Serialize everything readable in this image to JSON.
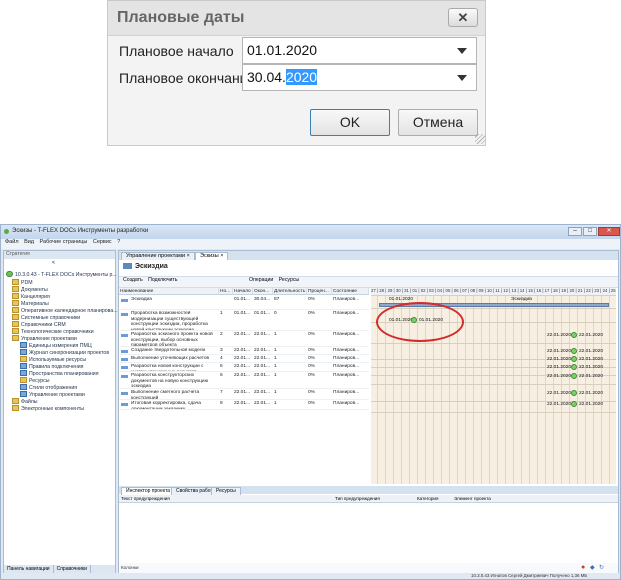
{
  "dialog": {
    "title": "Плановые даты",
    "close_icon": "close-x-icon",
    "start_label": "Плановое начало",
    "start_value": "01.01.2020",
    "end_label": "Плановое окончание",
    "end_value_plain": "30.04.",
    "end_value_selected": "2020",
    "ok_label": "OK",
    "cancel_label": "Отмена"
  },
  "app": {
    "title": "Эскизы - T-FLEX DOCs Инструменты разработки",
    "menu": [
      "Файл",
      "Вид",
      "Рабочие страницы",
      "Сервис",
      "?"
    ],
    "nav": {
      "header": "Стратегия",
      "root": "10.3.0.43 - T-FLEX DOCs Инструменты р...",
      "items": [
        "PDM",
        "Документы",
        "Канцелярия",
        "Материалы",
        "Оперативное календарное планирова...",
        "Системные справочники",
        "Справочники CRM",
        "Технологические справочники",
        "Управление проектами",
        "Единицы измерения ПМЦ",
        "Журнал синхронизации проектов",
        "Используемые ресурсы",
        "Правила подключения",
        "Пространства планирования",
        "Ресурсы",
        "Стили отображения",
        "Управление проектами",
        "Файлы",
        "Электронные компоненты"
      ],
      "bottom_tabs": [
        "Панель навигации",
        "Справочники"
      ]
    },
    "tabs": [
      "Управление проектами",
      "Эскизы"
    ],
    "doc_title": "Эскиздиа",
    "toolbar": [
      "Создать",
      "Подключить",
      "Операции",
      "Ресурсы"
    ],
    "grid": {
      "headers": [
        "Наименование",
        "Но...",
        "Начало",
        "Окон...",
        "Длительность",
        "Процен...",
        "Состояние"
      ],
      "rows": [
        {
          "name": "Эскиздиа",
          "no": "",
          "start": "01.01...",
          "end": "30.04...",
          "dur": "87",
          "pct": "0%",
          "state": "Планиров..."
        },
        {
          "name": "Проработка возможностей модернизации существующей конструкции эскиздиа, проработка новой конструкции эскиздиа, составление отчета",
          "no": "1",
          "start": "01.01...",
          "end": "01.01...",
          "dur": "0",
          "pct": "0%",
          "state": "Планиров..."
        },
        {
          "name": "Разработка эскизного проекта новой конструкции, выбор основных параметров объекта",
          "no": "2",
          "start": "22.01...",
          "end": "22.01...",
          "dur": "1",
          "pct": "0%",
          "state": "Планиров..."
        },
        {
          "name": "Создание твердотельной модели конструкции",
          "no": "3",
          "start": "22.01...",
          "end": "22.01...",
          "dur": "1",
          "pct": "0%",
          "state": "Планиров..."
        },
        {
          "name": "Выполнение уточняющих расчетов",
          "no": "4",
          "start": "22.01...",
          "end": "22.01...",
          "dur": "1",
          "pct": "0%",
          "state": "Планиров..."
        },
        {
          "name": "Разработка новой конструкции с учетом уточняющих расчетов",
          "no": "5",
          "start": "22.01...",
          "end": "22.01...",
          "dur": "1",
          "pct": "0%",
          "state": "Планиров..."
        },
        {
          "name": "Разработка конструкторских документов на новую конструкцию эскиздиа",
          "no": "6",
          "start": "22.01...",
          "end": "22.01...",
          "dur": "1",
          "pct": "0%",
          "state": "Планиров..."
        },
        {
          "name": "Выполнение сметного расчета конструкций",
          "no": "7",
          "start": "22.01...",
          "end": "22.01...",
          "dur": "1",
          "pct": "0%",
          "state": "Планиров..."
        },
        {
          "name": "Итоговая корректировка, сдача документации заказчику",
          "no": "8",
          "start": "22.01...",
          "end": "22.01...",
          "dur": "1",
          "pct": "0%",
          "state": "Планиров..."
        }
      ]
    },
    "gantt": {
      "head": "27 | 28 | 29 | 30 | 31 | 01 | 02 | 03 | 04 | 05 | 06 | 07 | 08 | 09 | 10 | 11 | 12 | 13 | 14 | 15 | 16 | 17 | 18 | 19 | 20 | 21 | 22 | 23 | 24 | 25 | 26",
      "summary_label": "Эскиздиа",
      "summary_start": "01.01.2020",
      "milestone_start": "01.01.2020",
      "milestone_end": "01.01.2020",
      "task_date": "22.01.2020"
    },
    "panel": {
      "tabs": [
        "Инспектор проекта",
        "Свойства работы",
        "Ресурсы"
      ],
      "headers": [
        "Текст предупреждения",
        "Тип предупреждения",
        "Категория",
        "Элемент проекта"
      ],
      "footer": "Колонки"
    },
    "status": "10.3.0.43  Игнатов Сергей Дмитриевич  Получено 1,36 МБ"
  }
}
